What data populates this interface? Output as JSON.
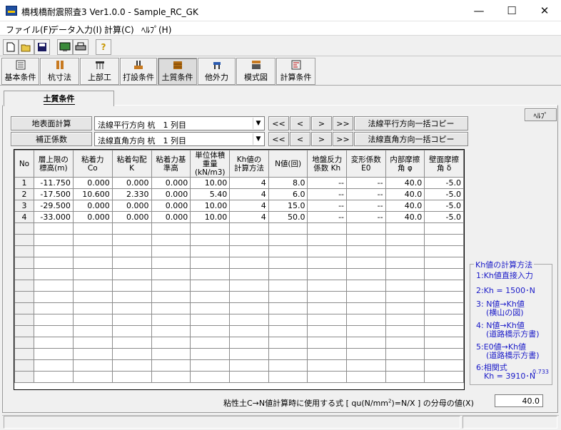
{
  "window": {
    "title": "橋桟橋耐震照査3 Ver1.0.0 - Sample_RC_GK",
    "minimize": "—",
    "maximize": "☐",
    "close": "✕"
  },
  "menu": [
    "ファイル(F)",
    "データ入力(I)",
    "計算(C)",
    "ﾍﾙﾌﾟ(H)"
  ],
  "toolbar": {
    "help_glyph": "?"
  },
  "tabs": [
    "基本条件",
    "杭寸法",
    "上部工",
    "打設条件",
    "土質条件",
    "他外力",
    "模式図",
    "計算条件"
  ],
  "active_tab": "土質条件",
  "page_tab": "土質条件",
  "help_button": "ﾍﾙﾌﾟ",
  "controls": {
    "row1": {
      "button": "地表面計算",
      "combo": "法線平行方向 杭　1 列目",
      "copy": "法線平行方向一括コピー"
    },
    "row2": {
      "button": "補正係数",
      "combo": "法線直角方向 杭　1 列目",
      "copy": "法線直角方向一括コピー"
    },
    "nav": [
      "<<",
      "<",
      ">",
      ">>"
    ]
  },
  "table": {
    "headers": [
      "No",
      "層上限の標高(m)",
      "粘着力 Co",
      "粘着勾配 K",
      "粘着力基準高",
      "単位体積重量 (kN/m3)",
      "Kh値の 計算方法",
      "N値(回)",
      "地盤反力係数 Kh",
      "変形係数 E0",
      "内部摩擦角 φ",
      "壁面摩擦角 δ"
    ],
    "rows": [
      [
        "1",
        "-11.750",
        "0.000",
        "0.000",
        "0.000",
        "10.00",
        "4",
        "8.0",
        "--",
        "--",
        "40.0",
        "-5.0"
      ],
      [
        "2",
        "-17.500",
        "10.600",
        "2.330",
        "0.000",
        "5.40",
        "4",
        "6.0",
        "--",
        "--",
        "40.0",
        "-5.0"
      ],
      [
        "3",
        "-29.500",
        "0.000",
        "0.000",
        "0.000",
        "10.00",
        "4",
        "15.0",
        "--",
        "--",
        "40.0",
        "-5.0"
      ],
      [
        "4",
        "-33.000",
        "0.000",
        "0.000",
        "0.000",
        "10.00",
        "4",
        "50.0",
        "--",
        "--",
        "40.0",
        "-5.0"
      ]
    ],
    "empty_rows": 14
  },
  "legend": {
    "title": "Kh値の計算方法",
    "items": [
      "1:Kh値直接入力",
      "2:Kh = 1500･N",
      "3: N値→Kh値",
      "(横山の図)",
      "4: N値→Kh値",
      "(道路橋示方書)",
      "5:E0値→Kh値",
      "(道路橋示方書)",
      "6:相関式",
      "Kh = 3910･N",
      "0.733"
    ]
  },
  "footer": {
    "label_a": "粘性土C→N値計算時に使用する式 [ qu(N/mm",
    "label_sup": "2",
    "label_b": ")=N/X ] の分母の値(X)",
    "value": "40.0"
  },
  "colors": {
    "legend_text": "#1a1ac8"
  }
}
